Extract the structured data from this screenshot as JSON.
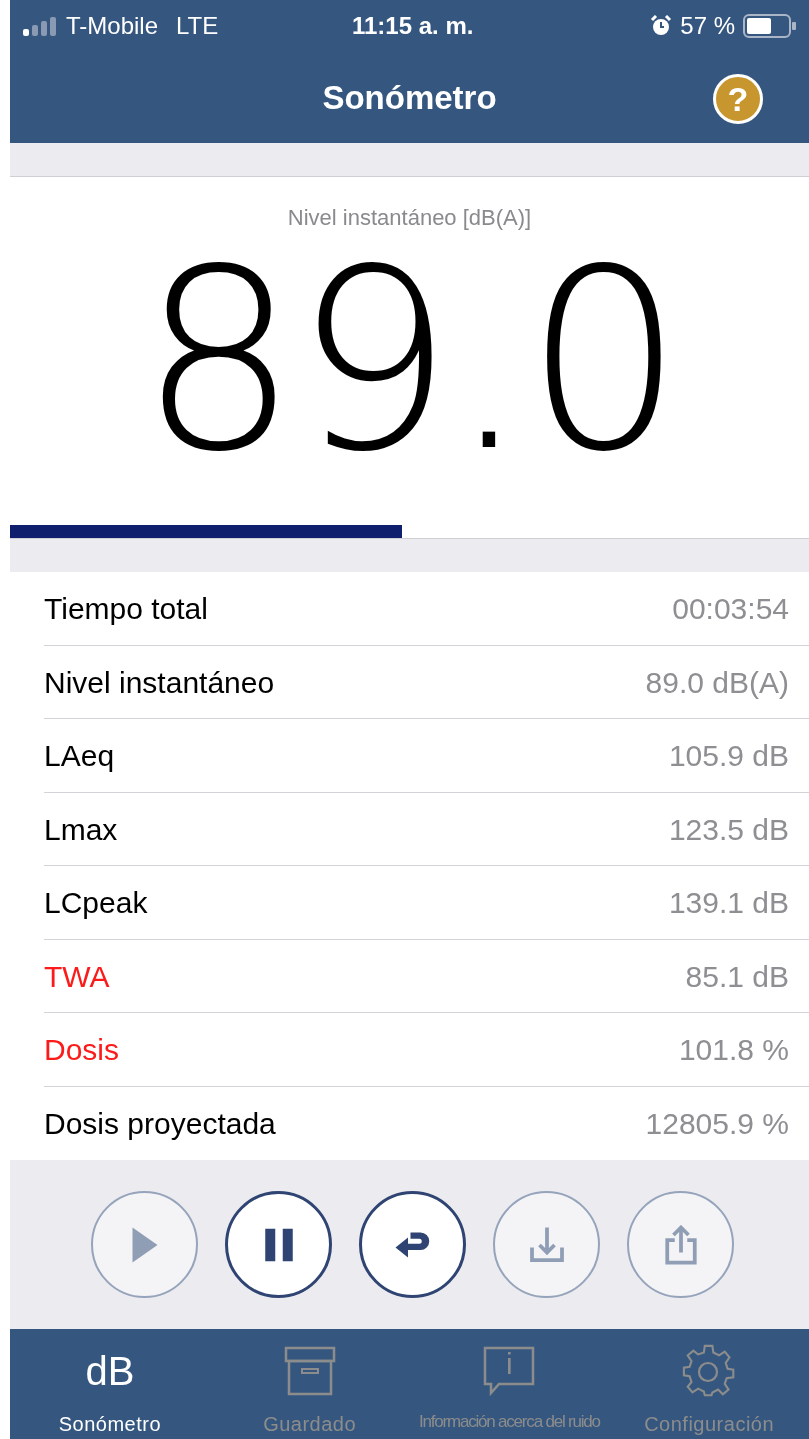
{
  "status_bar": {
    "carrier": "T-Mobile",
    "network": "LTE",
    "time": "11:15 a. m.",
    "battery": "57 %"
  },
  "header": {
    "title": "Sonómetro",
    "help": "?"
  },
  "meter": {
    "label": "Nivel instantáneo [dB(A)]",
    "value": "89.0",
    "level": 0.49
  },
  "rows": [
    {
      "label": "Tiempo total",
      "value": "00:03:54",
      "alert": false
    },
    {
      "label": "Nivel instantáneo",
      "value": "89.0 dB(A)",
      "alert": false
    },
    {
      "label": "LAeq",
      "value": "105.9 dB",
      "alert": false
    },
    {
      "label": "Lmax",
      "value": "123.5 dB",
      "alert": false
    },
    {
      "label": "LCpeak",
      "value": "139.1 dB",
      "alert": false
    },
    {
      "label": "TWA",
      "value": "85.1 dB",
      "alert": true
    },
    {
      "label": "Dosis",
      "value": "101.8 %",
      "alert": true
    },
    {
      "label": "Dosis proyectada",
      "value": "12805.9 %",
      "alert": false
    }
  ],
  "controls": [
    {
      "kind": "play",
      "disabled": true
    },
    {
      "kind": "pause",
      "disabled": false
    },
    {
      "kind": "reset",
      "disabled": false
    },
    {
      "kind": "save",
      "disabled": true
    },
    {
      "kind": "share",
      "disabled": true
    }
  ],
  "tabs": [
    {
      "kind": "db",
      "icon_text": "dB",
      "label": "Sonómetro",
      "selected": true
    },
    {
      "kind": "saved",
      "label": "Guardado",
      "selected": false
    },
    {
      "kind": "info",
      "icon_text": "i",
      "label": "Información acerca del ruido",
      "selected": false
    },
    {
      "kind": "settings",
      "label": "Configuración",
      "selected": false
    }
  ]
}
